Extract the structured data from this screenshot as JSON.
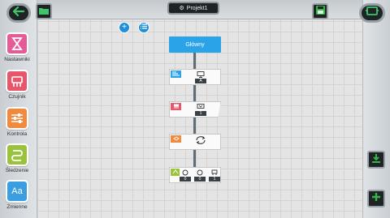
{
  "project": {
    "title": "Projekt1"
  },
  "palette": [
    {
      "label": "Nastawniki",
      "color": "#e55b98",
      "icon": "hourglass-icon"
    },
    {
      "label": "Czujnik",
      "color": "#e8566b",
      "icon": "sensor-icon"
    },
    {
      "label": "Kontrola",
      "color": "#f28a3d",
      "icon": "sliders-icon"
    },
    {
      "label": "Śledzenie",
      "color": "#9ac33b",
      "icon": "loop-icon"
    },
    {
      "label": "Zmienne",
      "color": "#3b9ee0",
      "icon": "variables-icon",
      "glyph": "Aa"
    }
  ],
  "program": {
    "start_label": "Główny",
    "blocks": [
      {
        "type": "display",
        "params": [
          "A"
        ],
        "tag_color": "#2aa3e8"
      },
      {
        "type": "sensor",
        "params": [
          "1"
        ],
        "tag_color": "#e8566b"
      },
      {
        "type": "loop",
        "params": [],
        "tag_color": "#f28a3d"
      },
      {
        "type": "motors",
        "params": [
          "0",
          "0",
          "1"
        ],
        "tag_color": "#9ac33b"
      }
    ]
  },
  "colors": {
    "accent": "#2aa3e8",
    "save_green": "#38b34a",
    "wire": "#5c6e7a"
  }
}
